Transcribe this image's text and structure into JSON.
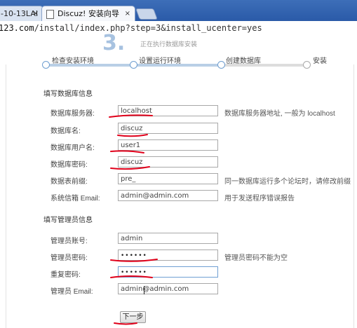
{
  "browser": {
    "tabs": [
      {
        "label": "-10-13LAI",
        "close": "×"
      },
      {
        "label": "Discuz! 安装向导",
        "close": "×"
      }
    ],
    "url_prefix": "123.com",
    "url_path": "/install/index.php?step=3&install_ucenter=yes"
  },
  "header": {
    "logo_fragment": "3.",
    "subtitle": "正在执行数据库安装"
  },
  "steps": [
    {
      "label": "检查安装环境"
    },
    {
      "label": "设置运行环境"
    },
    {
      "label": "创建数据库"
    },
    {
      "label": "安装"
    }
  ],
  "db_section": {
    "title": "填写数据库信息",
    "fields": [
      {
        "label": "数据库服务器:",
        "value": "localhost",
        "hint": "数据库服务器地址, 一般为 localhost"
      },
      {
        "label": "数据库名:",
        "value": "discuz",
        "hint": ""
      },
      {
        "label": "数据库用户名:",
        "value": "user1",
        "hint": ""
      },
      {
        "label": "数据库密码:",
        "value": "discuz",
        "hint": ""
      },
      {
        "label": "数据表前缀:",
        "value": "pre_",
        "hint": "同一数据库运行多个论坛时，请修改前缀"
      },
      {
        "label": "系统信箱 Email:",
        "value": "admin@admin.com",
        "hint": "用于发送程序错误报告"
      }
    ]
  },
  "admin_section": {
    "title": "填写管理员信息",
    "fields": [
      {
        "label": "管理员账号:",
        "value": "admin",
        "hint": ""
      },
      {
        "label": "管理员密码:",
        "value": "••••••",
        "hint": "管理员密码不能为空"
      },
      {
        "label": "重复密码:",
        "value": "••••••",
        "hint": ""
      },
      {
        "label": "管理员 Email:",
        "value": "admin@admin.com",
        "hint": ""
      }
    ]
  },
  "next_button": "下一步",
  "colors": {
    "annotation": "#e0001a",
    "tabbar": "#2f5faf",
    "progress": "#b9cfe6"
  }
}
